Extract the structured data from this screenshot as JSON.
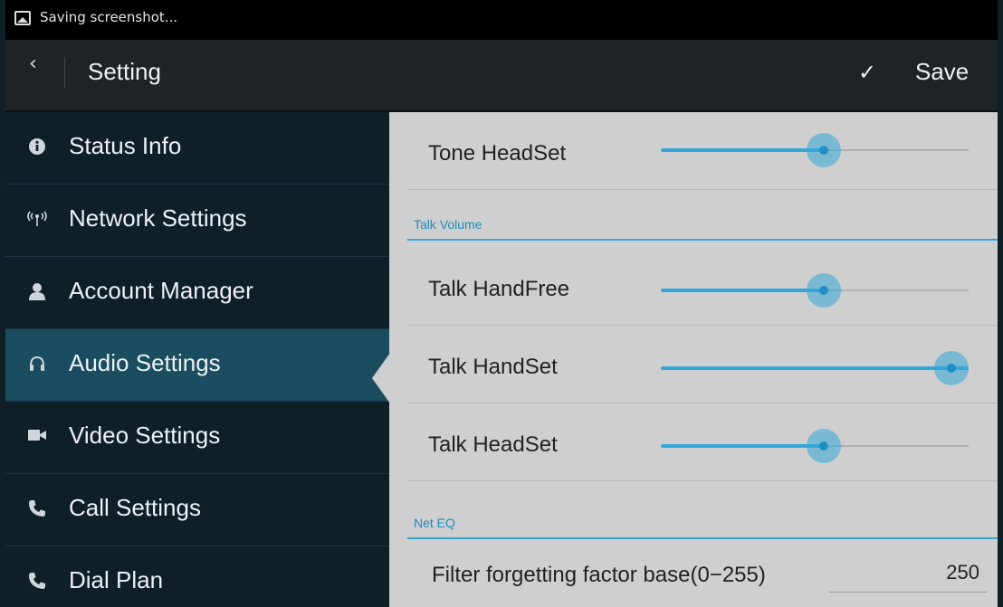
{
  "status_bar": {
    "notification": "Saving screenshot..."
  },
  "action_bar": {
    "back_icon": "‹",
    "title": "Setting",
    "save_check": "✓",
    "save_label": "Save"
  },
  "sidebar": {
    "items": [
      {
        "label": "Status Info",
        "icon": "info-icon"
      },
      {
        "label": "Network Settings",
        "icon": "antenna-icon"
      },
      {
        "label": "Account Manager",
        "icon": "person-icon"
      },
      {
        "label": "Audio Settings",
        "icon": "headset-icon",
        "active": true
      },
      {
        "label": "Video Settings",
        "icon": "camera-icon"
      },
      {
        "label": "Call Settings",
        "icon": "phone-icon"
      },
      {
        "label": "Dial Plan",
        "icon": "phone-icon"
      }
    ]
  },
  "content": {
    "tone_headset": {
      "label": "Tone HeadSet",
      "level_fraction": 0.53
    },
    "talk_volume_section": "Talk Volume",
    "talk_handfree": {
      "label": "Talk HandFree",
      "level_fraction": 0.53
    },
    "talk_handset": {
      "label": "Talk HandSet",
      "level_fraction": 1.0
    },
    "talk_headset": {
      "label": "Talk HeadSet",
      "level_fraction": 0.53
    },
    "net_eq_section": "Net EQ",
    "filter_forgetting": {
      "label": "Filter forgetting factor base(0−255)",
      "value": "250"
    }
  },
  "colors": {
    "accent": "#34a7d9",
    "sidebar_bg": "#0f1f28",
    "active_item": "#1a4d60",
    "content_bg": "#cfcfcf"
  }
}
